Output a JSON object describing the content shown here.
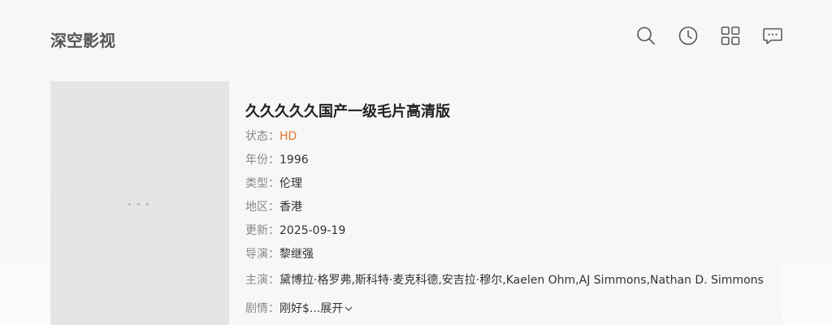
{
  "header": {
    "site_name": "深空影视",
    "icons": [
      "search-icon",
      "history-icon",
      "grid-icon",
      "message-icon"
    ]
  },
  "movie": {
    "title": "久久久久久国产一级毛片高清版",
    "fields": [
      {
        "label": "状态：",
        "value": "HD"
      },
      {
        "label": "年份：",
        "value": "1996"
      },
      {
        "label": "类型：",
        "value": "伦理"
      },
      {
        "label": "地区：",
        "value": "香港"
      },
      {
        "label": "更新：",
        "value": "2025-09-19"
      },
      {
        "label": "导演：",
        "value": "黎继强"
      },
      {
        "label": "主演：",
        "value": "黛博拉·格罗弗,斯科特·麦克科德,安吉拉·穆尔,Kaelen Ohm,AJ Simmons,Nathan D. Simmons"
      }
    ],
    "plot_label": "剧情：",
    "plot_value": "刚好$...",
    "plot_toggle": "展开"
  },
  "colors": {
    "status": "#e5762c",
    "label": "#888888",
    "poster_placeholder": "#e5e5e5"
  }
}
